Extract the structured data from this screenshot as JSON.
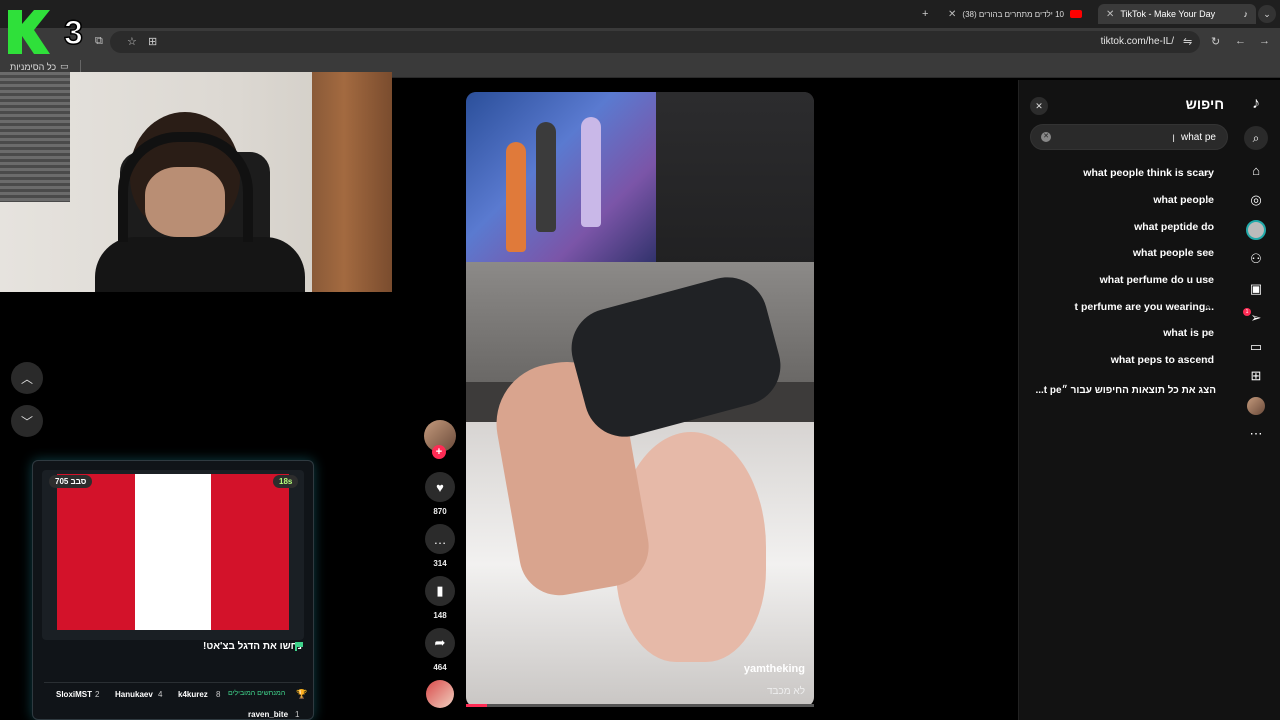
{
  "browser": {
    "tabs": [
      {
        "label": "TikTok - Make Your Day",
        "active": true
      },
      {
        "label": "10 ילדים מתחרים בהורים (38)",
        "active": false
      }
    ],
    "url": "tiktok.com/he-IL/",
    "bookmarks_label": "כל הסימניות"
  },
  "overlay": {
    "logo_text": "3"
  },
  "flag_widget": {
    "timer": "18s",
    "round": "סבב 705",
    "title": "נחשו את הדגל בצ'אט!",
    "leaderboard_label": "המנחשים המובילים",
    "leaders": [
      {
        "name": "k4kurez",
        "score": "8"
      },
      {
        "name": "Hanukaev",
        "score": "4"
      },
      {
        "name": "SloxiMST",
        "score": "2"
      },
      {
        "name": "raven_bite",
        "score": "1"
      }
    ],
    "flag_colors": {
      "red": "#d3122a",
      "white": "#ffffff"
    }
  },
  "video": {
    "author": "yamtheking",
    "caption": "לא מכבד",
    "progress": 0.06,
    "counts": {
      "likes": "870",
      "comments": "314",
      "saves": "148",
      "shares": "464"
    }
  },
  "search_panel": {
    "title": "חיפוש",
    "query": "what pe",
    "suggestions": [
      "what people think is scary",
      "what people",
      "what peptide do",
      "what people see",
      "what perfume do u use",
      "t perfume are you wearing...",
      "what is pe",
      "what peps to ascend"
    ],
    "show_all": "הצג את כל תוצאות החיפוש עבור ״t pe...",
    "notification_count": "1"
  },
  "colors": {
    "accent": "#fe2c55",
    "panel": "#121212"
  }
}
